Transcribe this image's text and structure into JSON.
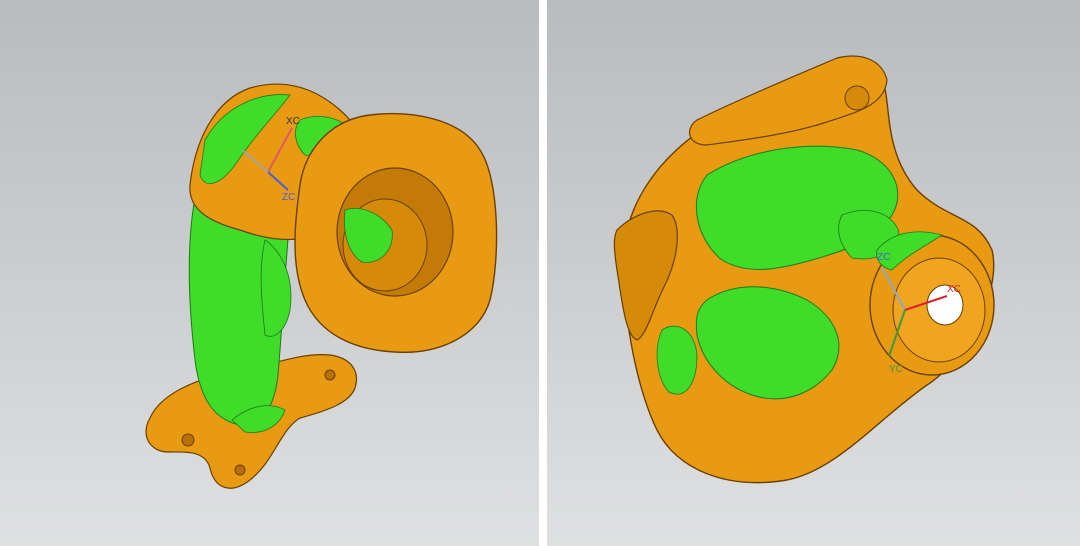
{
  "viewports": [
    {
      "id": "left",
      "axes": {
        "x": "XC",
        "z": "ZC"
      }
    },
    {
      "id": "right",
      "axes": {
        "x": "XC",
        "y": "YC",
        "z": "ZC"
      }
    }
  ],
  "colors": {
    "part_orange": "#e89a12",
    "part_orange_dark": "#b86f08",
    "deviation_green": "#3fdc2a",
    "deviation_green_dark": "#22a81a",
    "axis_x": "#d8252b",
    "axis_y": "#3a9a3a",
    "axis_z": "#4a5fd6",
    "background_top": "#b9bcbf",
    "background_bottom": "#dfe0e1"
  }
}
